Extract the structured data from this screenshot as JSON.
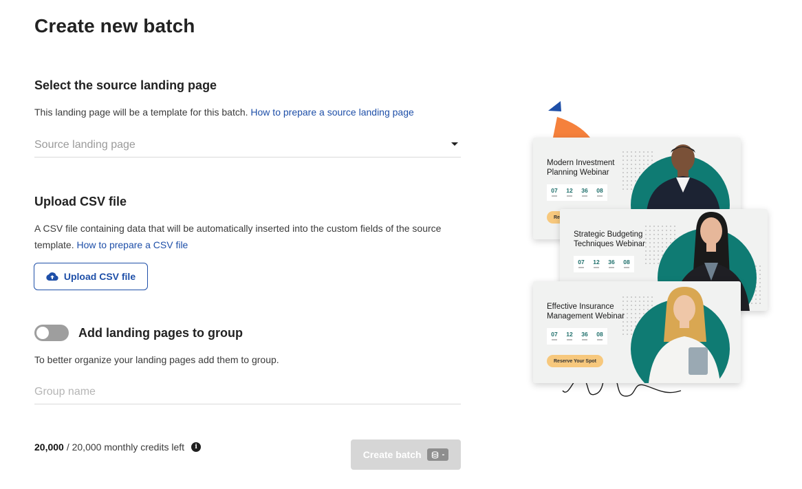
{
  "page": {
    "title": "Create new batch"
  },
  "source": {
    "title": "Select the source landing page",
    "desc": "This landing page will be a template for this batch.",
    "link": "How to prepare a source landing page",
    "placeholder": "Source landing page"
  },
  "csv": {
    "title": "Upload CSV file",
    "desc": "A CSV file containing data that will be automatically inserted into the custom fields of the source template.",
    "link": "How to prepare a CSV file",
    "button_label": "Upload CSV file"
  },
  "group": {
    "toggle_on": false,
    "title": "Add landing pages to group",
    "desc": "To better organize your landing pages add them to group.",
    "placeholder": "Group name"
  },
  "footer": {
    "credits_used": "20,000",
    "credits_rest": "/ 20,000 monthly credits left",
    "info_glyph": "i",
    "create_label": "Create batch",
    "credit_cost": "-"
  },
  "illustration": {
    "cards": [
      {
        "title": "Modern Investment Planning Webinar",
        "countdown": [
          "07",
          "12",
          "36",
          "08"
        ],
        "reserve": "Res"
      },
      {
        "title": "Strategic Budgeting Techniques Webinar",
        "countdown": [
          "07",
          "12",
          "36",
          "08"
        ]
      },
      {
        "title": "Effective Insurance Management Webinar",
        "countdown": [
          "07",
          "12",
          "36",
          "08"
        ],
        "reserve": "Reserve Your Spot"
      }
    ],
    "colors": {
      "teal": "#0f7b73",
      "orange": "#f5813c",
      "blue": "#1e4fa8",
      "button": "#f7c87d"
    }
  }
}
